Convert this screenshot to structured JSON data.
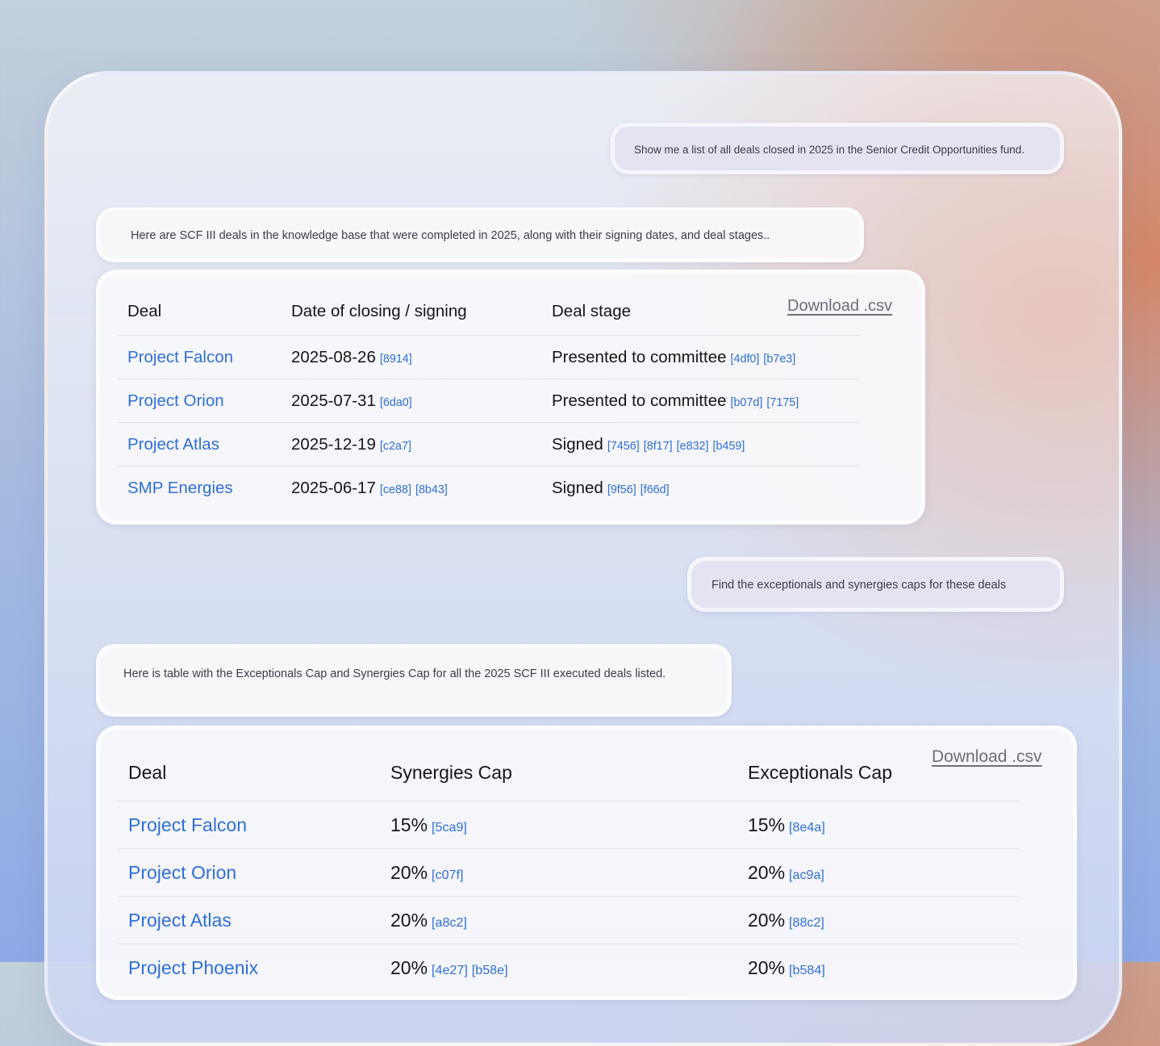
{
  "conversation": {
    "msg1_user": "Show me a list of all deals closed in 2025 in the Senior Credit Opportunities fund.",
    "msg2_assistant": "Here are SCF III deals in the knowledge base that were completed in 2025, along with their signing dates, and deal stages..",
    "msg3_user": "Find the exceptionals and synergies caps for these deals",
    "msg4_assistant": "Here is table with the Exceptionals Cap and Synergies Cap for all the 2025 SCF III executed deals listed."
  },
  "table1": {
    "download_label": "Download .csv",
    "headers": [
      "Deal",
      "Date of closing / signing",
      "Deal stage"
    ],
    "rows": [
      {
        "deal": "Project Falcon",
        "date": "2025-08-26",
        "date_refs": [
          "[8914]"
        ],
        "stage": "Presented to committee",
        "stage_refs": [
          "[4df0]",
          "[b7e3]"
        ]
      },
      {
        "deal": "Project Orion",
        "date": "2025-07-31",
        "date_refs": [
          "[6da0]"
        ],
        "stage": "Presented to committee",
        "stage_refs": [
          "[b07d]",
          "[7175]"
        ]
      },
      {
        "deal": "Project Atlas",
        "date": "2025-12-19",
        "date_refs": [
          "[c2a7]"
        ],
        "stage": "Signed",
        "stage_refs": [
          "[7456]",
          "[8f17]",
          "[e832]",
          "[b459]"
        ]
      },
      {
        "deal": "SMP Energies",
        "date": "2025-06-17",
        "date_refs": [
          "[ce88]",
          "[8b43]"
        ],
        "stage": "Signed",
        "stage_refs": [
          "[9f56]",
          "[f66d]"
        ]
      }
    ]
  },
  "table2": {
    "download_label": "Download .csv",
    "headers": [
      "Deal",
      "Synergies Cap",
      "Exceptionals Cap"
    ],
    "rows": [
      {
        "deal": "Project Falcon",
        "syn": "15%",
        "syn_refs": [
          "[5ca9]"
        ],
        "exc": "15%",
        "exc_refs": [
          "[8e4a]"
        ]
      },
      {
        "deal": "Project Orion",
        "syn": "20%",
        "syn_refs": [
          "[c07f]"
        ],
        "exc": "20%",
        "exc_refs": [
          "[ac9a]"
        ]
      },
      {
        "deal": "Project Atlas",
        "syn": "20%",
        "syn_refs": [
          "[a8c2]"
        ],
        "exc": "20%",
        "exc_refs": [
          "[88c2]"
        ]
      },
      {
        "deal": "Project Phoenix",
        "syn": "20%",
        "syn_refs": [
          "[4e27]",
          "[b58e]"
        ],
        "exc": "20%",
        "exc_refs": [
          "[b584]"
        ]
      }
    ]
  }
}
